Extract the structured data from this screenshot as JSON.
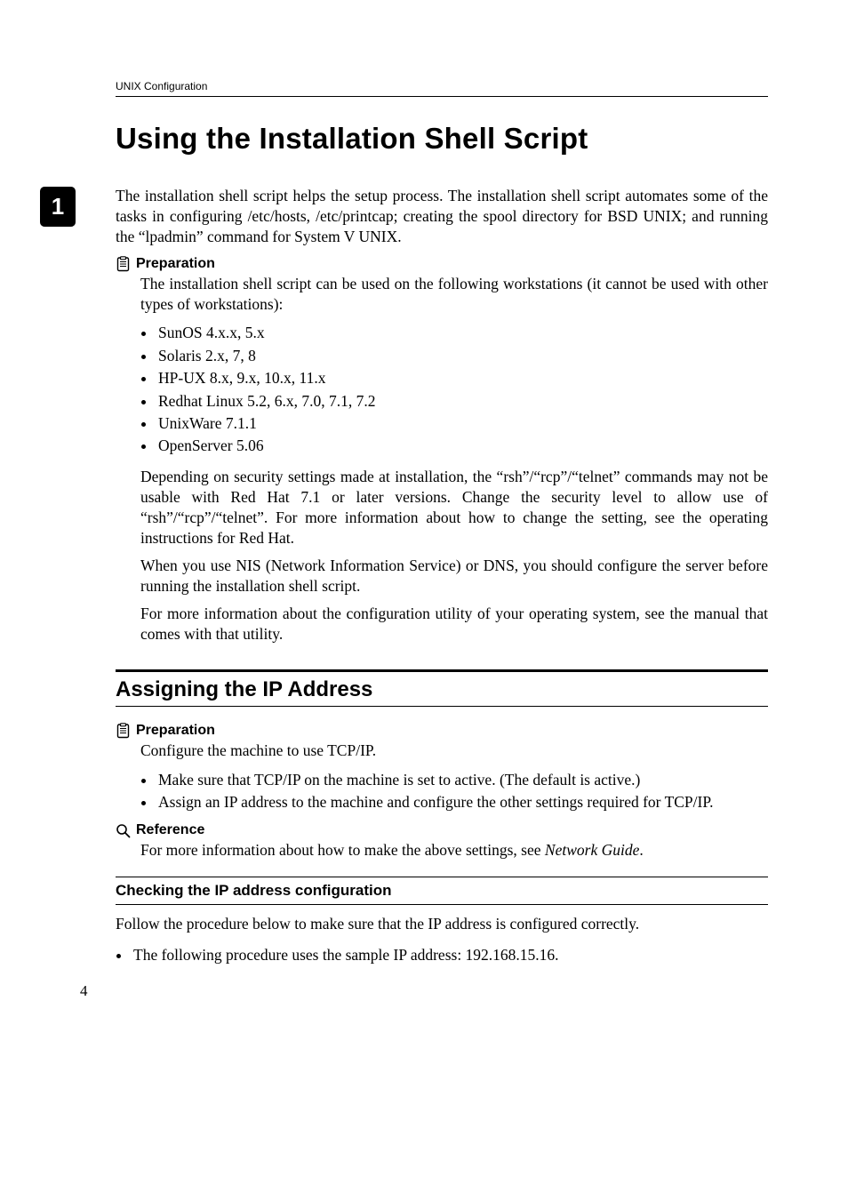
{
  "runningHeader": "UNIX Configuration",
  "chapterTab": "1",
  "title": "Using the Installation Shell Script",
  "intro": "The installation shell script helps the setup process. The installation shell script automates some of the tasks in configuring /etc/hosts, /etc/printcap; creating the spool directory for BSD UNIX; and running the “lpadmin” command for System V UNIX.",
  "prepLabel": "Preparation",
  "prep1_p1": "The installation shell script can be used on the following workstations (it cannot be used with other types of workstations):",
  "prep1_bullets": [
    "SunOS 4.x.x, 5.x",
    "Solaris 2.x, 7, 8",
    "HP-UX 8.x, 9.x, 10.x, 11.x",
    "Redhat Linux 5.2, 6.x, 7.0, 7.1, 7.2",
    "UnixWare 7.1.1",
    "OpenServer 5.06"
  ],
  "prep1_p2": "Depending on security settings made at installation, the “rsh”/“rcp”/“telnet” commands may not be usable with Red Hat 7.1 or later versions. Change the security level to allow use of “rsh”/“rcp”/“telnet”. For more information about how to change the setting, see the operating instructions for Red Hat.",
  "prep1_p3": "When you use NIS (Network Information Service) or DNS, you should configure the server before running the installation shell script.",
  "prep1_p4": "For more information about the configuration utility of your operating system, see the manual that comes with that utility.",
  "sectionTitle": "Assigning the IP Address",
  "prep2_p1": "Configure the machine to use TCP/IP.",
  "prep2_bullets": [
    "Make sure that TCP/IP on the machine is set to active. (The default is active.)",
    "Assign an IP address to the machine and configure the other settings required for TCP/IP."
  ],
  "refLabel": "Reference",
  "ref_p1_a": "For more information about how to make the above settings, see ",
  "ref_p1_italic": "Network Guide",
  "ref_p1_b": ".",
  "subsectionTitle": "Checking the IP address configuration",
  "sub_p1": "Follow the procedure below to make sure that the IP address is configured correctly.",
  "sub_bullets": [
    "The following procedure uses the sample IP address: 192.168.15.16."
  ],
  "pageNumber": "4"
}
